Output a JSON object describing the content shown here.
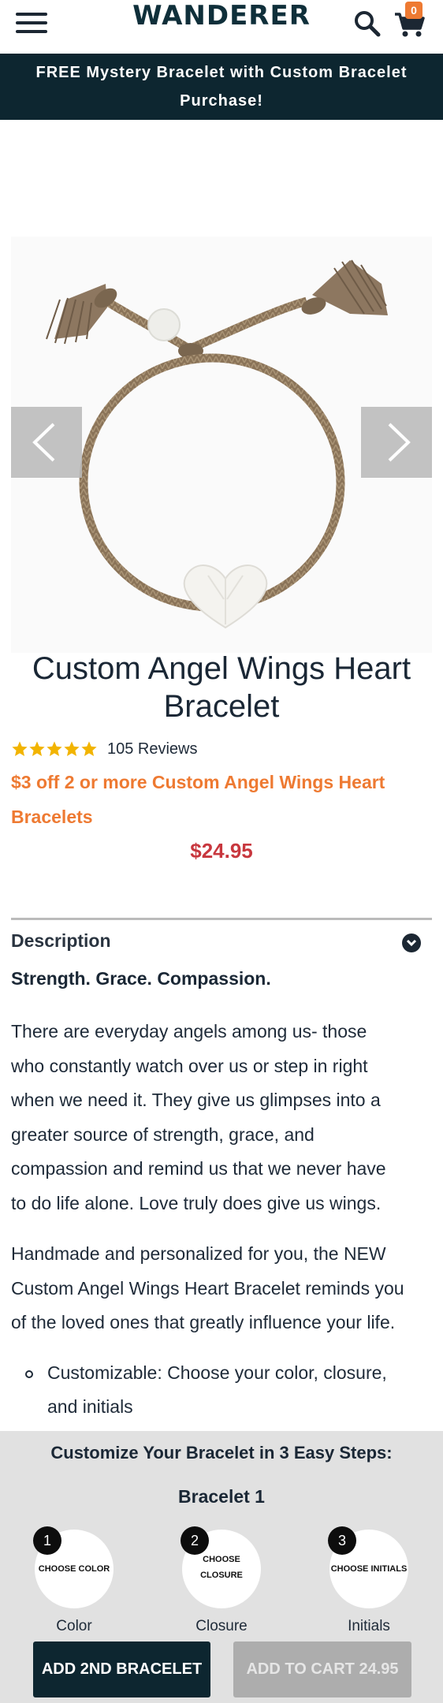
{
  "header": {
    "logo": "WANDERER",
    "cart_count": "0",
    "icons": [
      "hamburger-menu-icon",
      "search-icon",
      "cart-icon"
    ]
  },
  "promo_banner": {
    "line1": "FREE Mystery Bracelet with Custom Bracelet",
    "line2": "Purchase!"
  },
  "gallery": {
    "icons": [
      "chevron-left-icon",
      "chevron-right-icon"
    ]
  },
  "product": {
    "title_line1": "Custom Angel Wings Heart",
    "title_line2": "Bracelet",
    "rating_stars": 5,
    "reviews": "105 Reviews",
    "promo_line1": "$3 off 2 or more Custom Angel Wings Heart",
    "promo_line2": "Bracelets",
    "price": "$24.95"
  },
  "description": {
    "header": "Description",
    "tagline": "Strength. Grace. Compassion.",
    "para1": [
      "There are everyday angels among us- those",
      "who constantly watch over us or step in right",
      "when we need it. They give us glimpses into a",
      "greater source of strength, grace, and",
      "compassion and remind us that we never have",
      "to do life alone. Love truly does give us wings."
    ],
    "para2": [
      "Handmade and personalized for you, the NEW",
      "Custom Angel Wings Heart Bracelet reminds you",
      "of the loved ones that greatly influence your life."
    ],
    "bullet": [
      "Customizable: Choose your color, closure,",
      "and initials"
    ]
  },
  "customize": {
    "title": "Customize Your Bracelet in 3 Easy Steps:",
    "bracelet_label": "Bracelet 1",
    "steps": [
      {
        "num": "1",
        "circle_text_1": "CHOOSE COLOR",
        "circle_text_2": "",
        "label": "Color"
      },
      {
        "num": "2",
        "circle_text_1": "CHOOSE",
        "circle_text_2": "CLOSURE",
        "label": "Closure"
      },
      {
        "num": "3",
        "circle_text_1": "CHOOSE INITIALS",
        "circle_text_2": "",
        "label": "Initials"
      }
    ],
    "add_second_button": "ADD 2ND BRACELET",
    "add_to_cart_button": "ADD TO CART 24.95"
  },
  "colors": {
    "brand_dark": "#0d2630",
    "accent_orange": "#ee7a32",
    "price_red": "#c8373e",
    "star_gold": "#f2b400"
  }
}
